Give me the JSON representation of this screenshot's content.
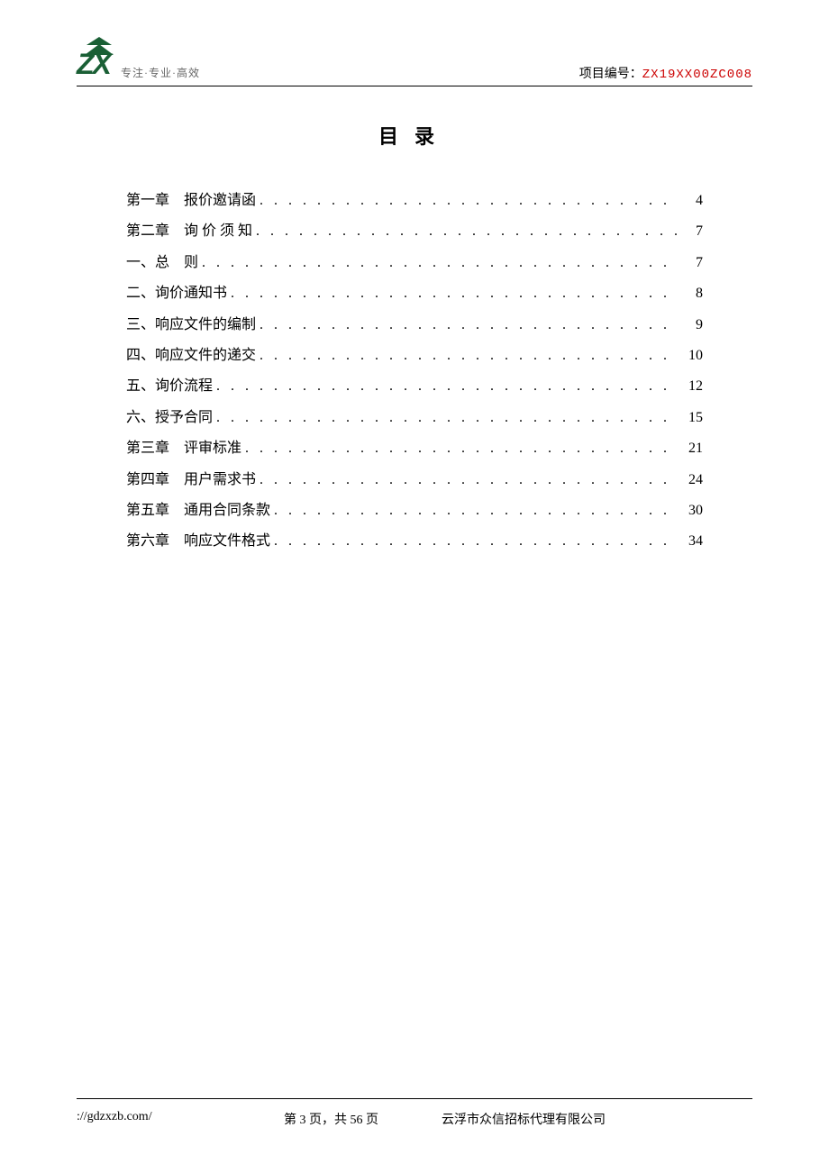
{
  "header": {
    "logo_text": "ZX",
    "tagline": "专注·专业·高效",
    "project_label": "项目编号：",
    "project_code": "ZX19XX00ZC008"
  },
  "title": "目录",
  "toc": [
    {
      "label": "第一章　报价邀请函",
      "page": "4"
    },
    {
      "label": "第二章　询 价 须 知",
      "page": "7"
    },
    {
      "label": "一、总　则",
      "page": "7"
    },
    {
      "label": "二、询价通知书",
      "page": "8"
    },
    {
      "label": "三、响应文件的编制",
      "page": "9"
    },
    {
      "label": "四、响应文件的递交",
      "page": "10"
    },
    {
      "label": "五、询价流程",
      "page": "12"
    },
    {
      "label": "六、授予合同",
      "page": "15"
    },
    {
      "label": "第三章　评审标准",
      "page": "21"
    },
    {
      "label": "第四章　用户需求书",
      "page": "24"
    },
    {
      "label": "第五章　通用合同条款",
      "page": "30"
    },
    {
      "label": "第六章　响应文件格式",
      "page": "34"
    }
  ],
  "footer": {
    "url": "://gdzxzb.com/",
    "page_text": "第 3 页，共 56 页",
    "company": "云浮市众信招标代理有限公司"
  }
}
